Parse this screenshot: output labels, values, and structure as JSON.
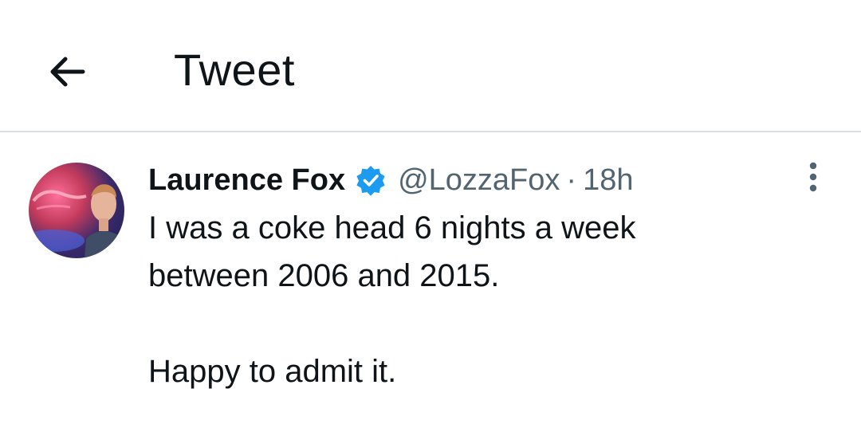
{
  "header": {
    "back_icon": "arrow-left-icon",
    "title": "Tweet"
  },
  "tweet": {
    "author": {
      "name": "Laurence Fox",
      "verified": true,
      "verified_color": "#1d9bf0",
      "handle": "@LozzaFox",
      "avatar_icon": "user-avatar"
    },
    "separator": "·",
    "time": "18h",
    "text_lines": [
      "I was a coke head 6 nights a week",
      "between 2006 and 2015.",
      "",
      "Happy to admit it."
    ],
    "more_icon": "more-vertical-icon"
  },
  "colors": {
    "text_primary": "#0f1419",
    "text_secondary": "#536471",
    "divider": "#d9e1e6",
    "accent": "#1d9bf0"
  }
}
